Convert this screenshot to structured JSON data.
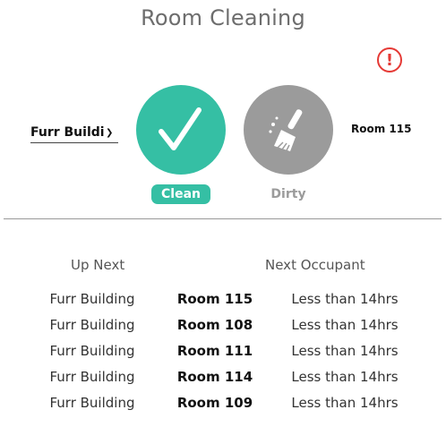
{
  "page": {
    "title": "Room Cleaning"
  },
  "alert": {
    "symbol": "!",
    "color": "#e53935"
  },
  "building_select": {
    "value": "Furr Building"
  },
  "status": {
    "clean_label": "Clean",
    "dirty_label": "Dirty",
    "selected": "Clean",
    "clean_color": "#35bfa4",
    "dirty_color": "#9b9b9b"
  },
  "current_room": "Room 115",
  "table": {
    "headers": {
      "up_next": "Up Next",
      "next_occupant": "Next Occupant"
    },
    "rows": [
      {
        "building": "Furr Building",
        "room": "Room 115",
        "occupant": "Less than 14hrs"
      },
      {
        "building": "Furr Building",
        "room": "Room 108",
        "occupant": "Less than 14hrs"
      },
      {
        "building": "Furr Building",
        "room": "Room 111",
        "occupant": "Less than 14hrs"
      },
      {
        "building": "Furr Building",
        "room": "Room 114",
        "occupant": "Less than 14hrs"
      },
      {
        "building": "Furr Building",
        "room": "Room 109",
        "occupant": "Less than 14hrs"
      }
    ]
  }
}
